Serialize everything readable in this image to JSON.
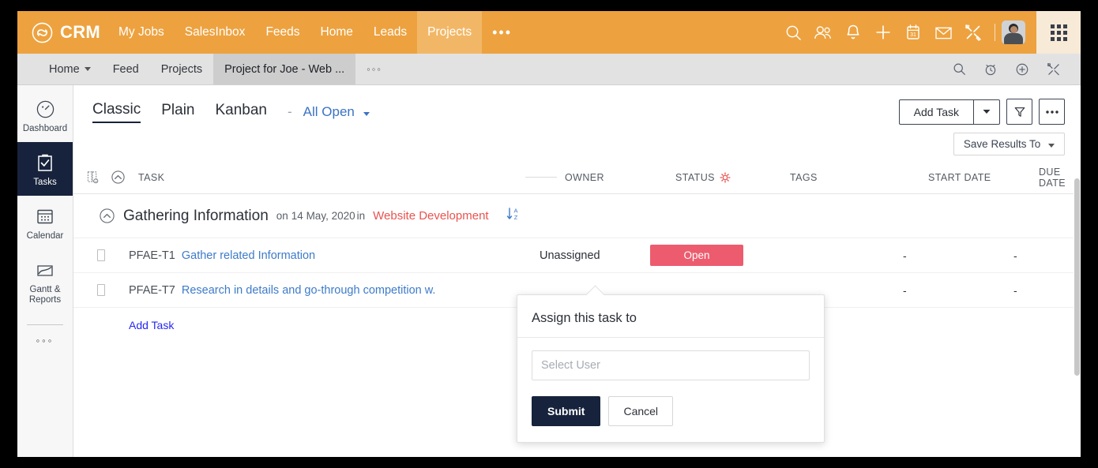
{
  "topbar": {
    "brand": "CRM",
    "brand_icon": "infinity-logo-icon",
    "nav": [
      {
        "label": "My Jobs",
        "active": false
      },
      {
        "label": "SalesInbox",
        "active": false
      },
      {
        "label": "Feeds",
        "active": false
      },
      {
        "label": "Home",
        "active": false
      },
      {
        "label": "Leads",
        "active": false
      },
      {
        "label": "Projects",
        "active": true
      }
    ],
    "more_label": "•••",
    "icons": [
      "search-icon",
      "contacts-icon",
      "notifications-bell-icon",
      "add-plus-icon",
      "calendar-31-icon",
      "mail-envelope-icon",
      "tools-setup-icon"
    ],
    "avatar_name": "user-avatar",
    "app_grid": "app-grid-icon",
    "accent_color": "#eda23f",
    "accent_active_color": "#f2b766",
    "app_grid_bg": "#f7ead7"
  },
  "subbar": {
    "items": [
      {
        "label": "Home",
        "has_caret": true,
        "active": false
      },
      {
        "label": "Feed",
        "has_caret": false,
        "active": false
      },
      {
        "label": "Projects",
        "has_caret": false,
        "active": false
      },
      {
        "label": "Project for Joe - Web ...",
        "has_caret": false,
        "active": true
      }
    ],
    "more_label": "◦◦◦",
    "icons": [
      "search-icon",
      "timer-alarm-icon",
      "add-circle-icon",
      "tools-setup-icon"
    ]
  },
  "sidebar": {
    "items": [
      {
        "label": "Dashboard",
        "icon": "dashboard-gauge-icon",
        "active": false
      },
      {
        "label": "Tasks",
        "icon": "tasks-clipboard-icon",
        "active": true
      },
      {
        "label": "Calendar",
        "icon": "calendar-icon",
        "active": false
      },
      {
        "label": "Gantt & Reports",
        "icon": "gantt-chart-icon",
        "active": false
      }
    ],
    "more_label": "◦◦◦",
    "active_bg": "#17233c"
  },
  "viewbar": {
    "tabs": [
      {
        "label": "Classic",
        "active": true
      },
      {
        "label": "Plain",
        "active": false
      },
      {
        "label": "Kanban",
        "active": false
      }
    ],
    "separator": "-",
    "filter_label": "All Open",
    "add_task_label": "Add Task",
    "filter_icon": "funnel-filter-icon",
    "more_icon": "more-options-icon",
    "save_results_label": "Save Results To"
  },
  "table": {
    "columns": [
      {
        "key": "task",
        "label": "TASK"
      },
      {
        "key": "owner",
        "label": "OWNER"
      },
      {
        "key": "status",
        "label": "STATUS"
      },
      {
        "key": "tags",
        "label": "TAGS"
      },
      {
        "key": "start",
        "label": "START DATE"
      },
      {
        "key": "due",
        "label": "DUE DATE"
      }
    ],
    "header_icons": [
      "column-settings-icon",
      "collapse-all-icon"
    ],
    "status_gear_icon": "status-settings-gear-icon",
    "status_gear_color": "#e8534f",
    "milestone": {
      "name": "Gathering Information",
      "date_prefix": "on",
      "date": "14 May, 2020",
      "in_label": "in",
      "project": "Website Development",
      "project_color": "#e8534f",
      "collapse_icon": "collapse-chevron-icon",
      "sort_icon": "sort-az-icon"
    },
    "rows": [
      {
        "key": "PFAE-T1",
        "title": "Gather related Information",
        "owner": "Unassigned",
        "status": "Open",
        "status_color": "#ec5c6e",
        "tags": "",
        "start": "-",
        "due": "-"
      },
      {
        "key": "PFAE-T7",
        "title": "Research in details and go-through competition w.",
        "owner": "",
        "status": "",
        "tags": "",
        "start": "-",
        "due": "-"
      }
    ],
    "add_task_label": "Add Task",
    "add_task_color": "#2727f5"
  },
  "popup": {
    "title": "Assign this task to",
    "select_user_value": "",
    "select_user_placeholder": "Select User",
    "submit_label": "Submit",
    "cancel_label": "Cancel",
    "submit_color": "#17233c"
  }
}
